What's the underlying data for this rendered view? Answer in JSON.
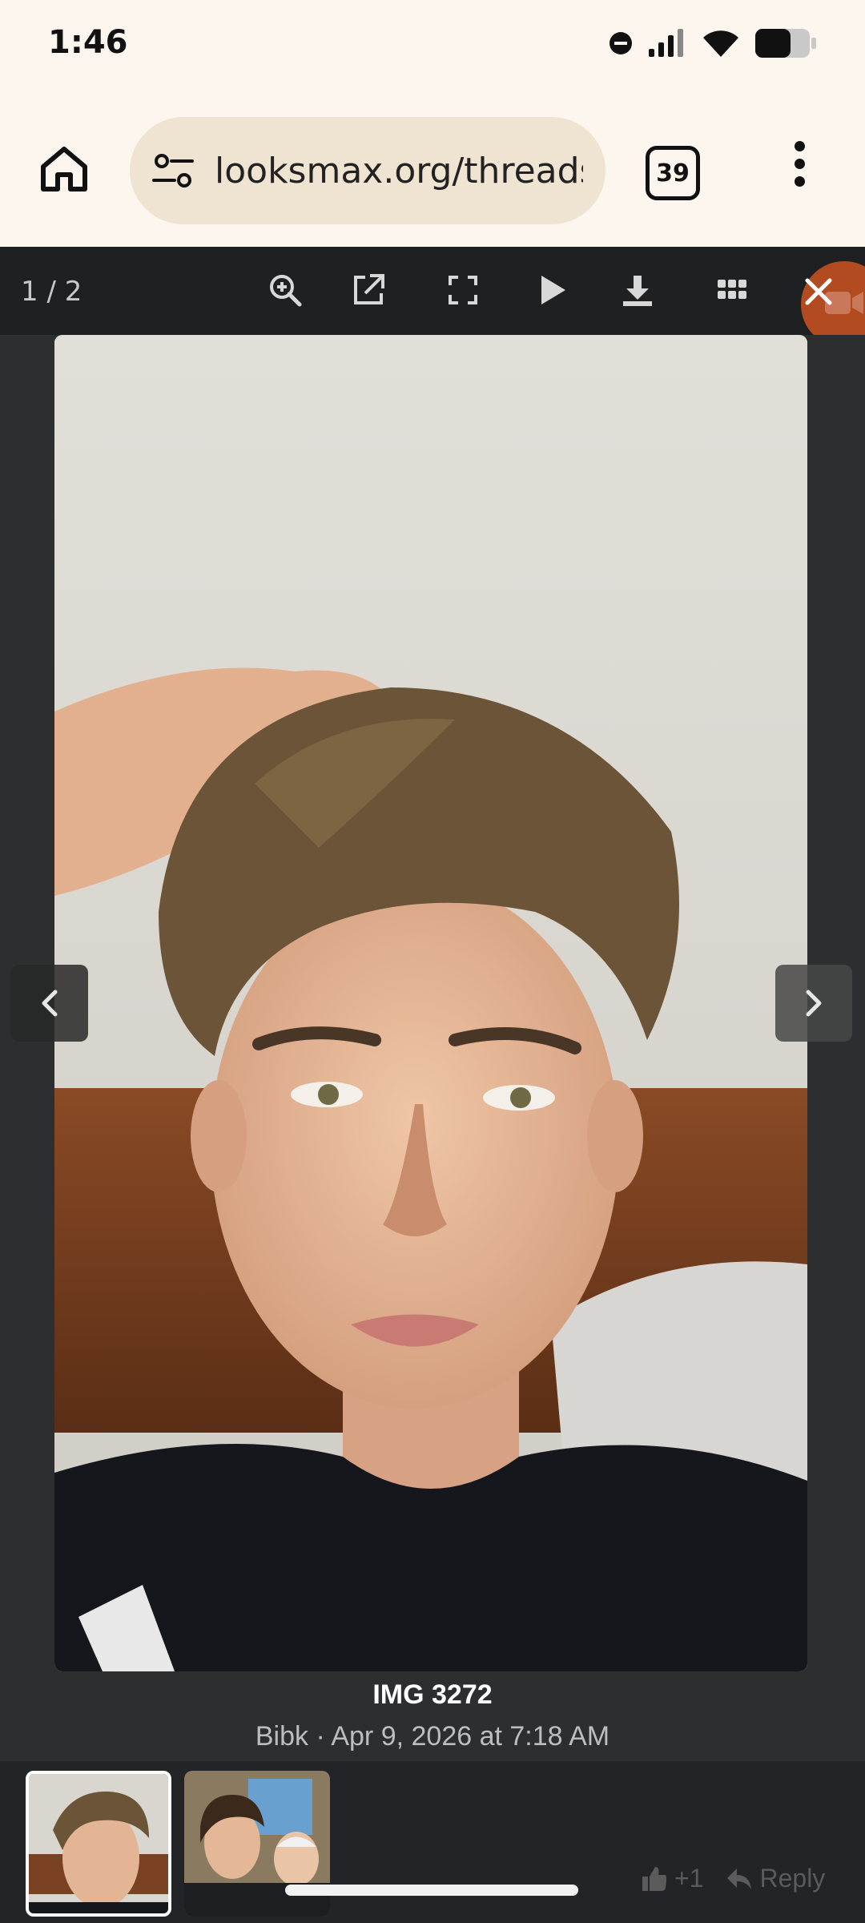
{
  "status_bar": {
    "time": "1:46",
    "icons": [
      "do-not-disturb-icon",
      "signal-icon",
      "wifi-icon",
      "battery-icon"
    ]
  },
  "browser": {
    "url": "looksmax.org/threads/",
    "tab_count": "39",
    "icons": [
      "home-icon",
      "site-settings-icon",
      "more-vert-icon"
    ]
  },
  "lightbox": {
    "counter": "1 / 2",
    "tools": [
      "zoom-in-icon",
      "open-new-tab-icon",
      "fullscreen-icon",
      "play-icon",
      "download-icon",
      "thumbnails-icon",
      "close-icon"
    ],
    "photo_alt": "selfie photo",
    "caption_title": "IMG 3272",
    "caption_meta": "Bibk · Apr 9, 2026 at 7:18 AM",
    "thumbnails": [
      "thumbnail-1",
      "thumbnail-2"
    ],
    "active_thumbnail": 0
  },
  "post": {
    "like_count": "+1",
    "reply_label": "Reply"
  },
  "colors": {
    "browser_bg": "#fdf6ef",
    "url_pill": "#efe3d2",
    "lightbox_bg": "#2d2e30",
    "toolbar_bg": "#1f2022",
    "close_accent": "#b24b1f"
  }
}
